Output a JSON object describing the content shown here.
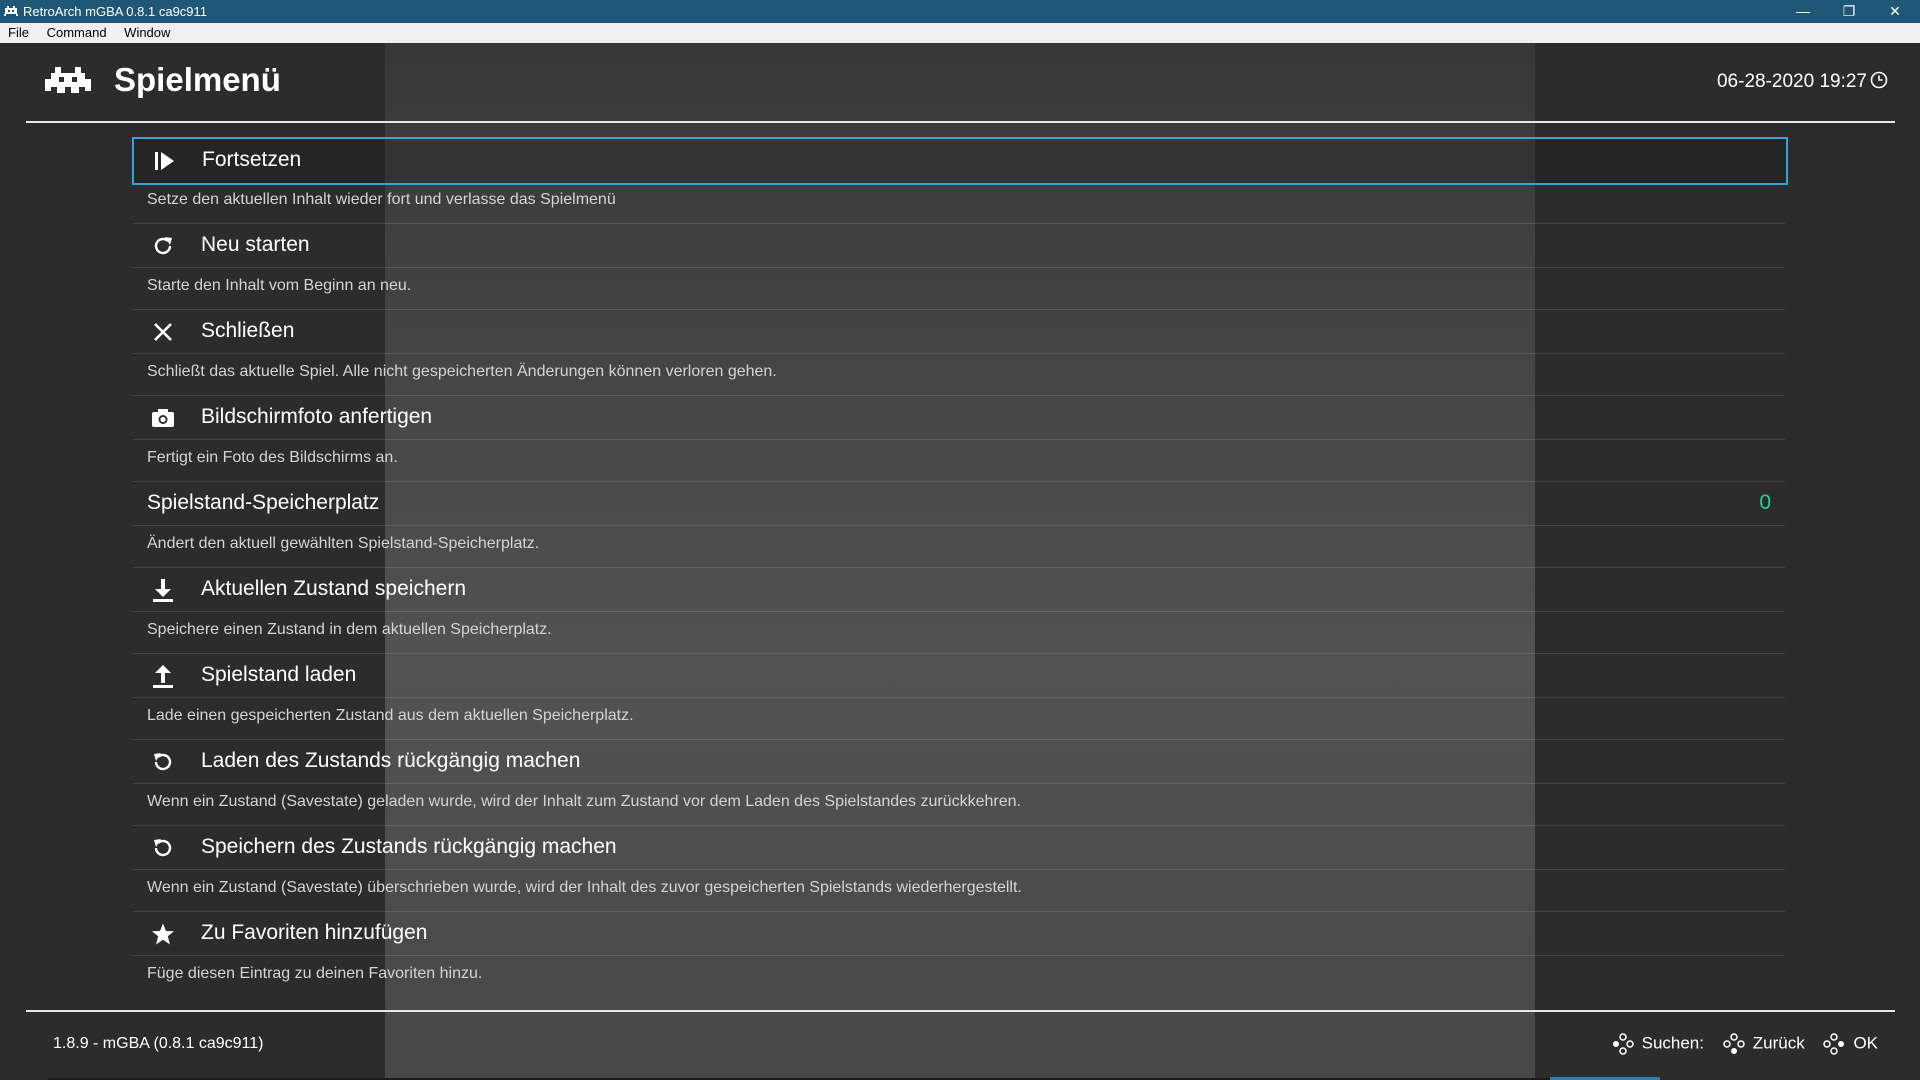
{
  "window": {
    "title": "RetroArch mGBA 0.8.1 ca9c911",
    "minimize_icon": "minimize-icon",
    "maximize_icon": "restore-icon",
    "close_icon": "close-icon"
  },
  "menubar": {
    "items": [
      "File",
      "Command",
      "Window"
    ]
  },
  "header": {
    "title": "Spielmenü",
    "datetime": "06-28-2020 19:27",
    "logo_icon": "retroarch-invader-icon",
    "clock_icon": "clock-icon"
  },
  "menu": {
    "items": [
      {
        "label": "Fortsetzen",
        "sublabel": "Setze den aktuellen Inhalt wieder fort und verlasse das Spielmenü",
        "icon": "resume-icon",
        "selected": true
      },
      {
        "label": "Neu starten",
        "sublabel": "Starte den Inhalt vom Beginn an neu.",
        "icon": "restart-icon"
      },
      {
        "label": "Schließen",
        "sublabel": "Schließt das aktuelle Spiel. Alle nicht gespeicherten Änderungen können verloren gehen.",
        "icon": "close-content-icon"
      },
      {
        "label": "Bildschirmfoto anfertigen",
        "sublabel": "Fertigt ein Foto des Bildschirms an.",
        "icon": "camera-icon"
      },
      {
        "label": "Spielstand-Speicherplatz",
        "sublabel": "Ändert den aktuell gewählten Spielstand-Speicherplatz.",
        "value": "0"
      },
      {
        "label": "Aktuellen Zustand speichern",
        "sublabel": "Speichere einen Zustand in dem aktuellen Speicherplatz.",
        "icon": "save-state-icon"
      },
      {
        "label": "Spielstand laden",
        "sublabel": "Lade einen gespeicherten Zustand aus dem aktuellen Speicherplatz.",
        "icon": "load-state-icon"
      },
      {
        "label": "Laden des Zustands rückgängig machen",
        "sublabel": "Wenn ein Zustand (Savestate) geladen wurde, wird der Inhalt zum Zustand vor dem Laden des Spielstandes zurückkehren.",
        "icon": "undo-load-icon"
      },
      {
        "label": "Speichern des Zustands rückgängig machen",
        "sublabel": "Wenn ein Zustand (Savestate) überschrieben wurde, wird der Inhalt des zuvor gespeicherten Spielstands wiederhergestellt.",
        "icon": "undo-save-icon"
      },
      {
        "label": "Zu Favoriten hinzufügen",
        "sublabel": "Füge diesen Eintrag zu deinen Favoriten hinzu.",
        "icon": "star-icon"
      }
    ]
  },
  "footer": {
    "core_info": "1.8.9 - mGBA (0.8.1 ca9c911)",
    "search_label": "Suchen:",
    "back_label": "Zurück",
    "ok_label": "OK"
  },
  "colors": {
    "titlebar": "#1f5776",
    "selection_border": "#39a3d6",
    "value_accent": "#19d3a6"
  }
}
